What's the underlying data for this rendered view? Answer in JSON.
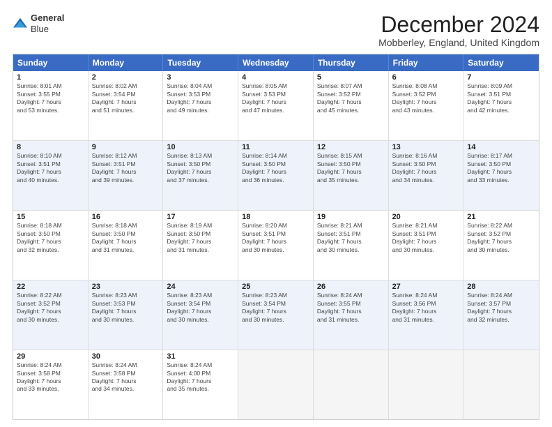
{
  "header": {
    "logo": {
      "line1": "General",
      "line2": "Blue"
    },
    "title": "December 2024",
    "location": "Mobberley, England, United Kingdom"
  },
  "weekdays": [
    "Sunday",
    "Monday",
    "Tuesday",
    "Wednesday",
    "Thursday",
    "Friday",
    "Saturday"
  ],
  "rows": [
    [
      {
        "day": "1",
        "info": "Sunrise: 8:01 AM\nSunset: 3:55 PM\nDaylight: 7 hours\nand 53 minutes."
      },
      {
        "day": "2",
        "info": "Sunrise: 8:02 AM\nSunset: 3:54 PM\nDaylight: 7 hours\nand 51 minutes."
      },
      {
        "day": "3",
        "info": "Sunrise: 8:04 AM\nSunset: 3:53 PM\nDaylight: 7 hours\nand 49 minutes."
      },
      {
        "day": "4",
        "info": "Sunrise: 8:05 AM\nSunset: 3:53 PM\nDaylight: 7 hours\nand 47 minutes."
      },
      {
        "day": "5",
        "info": "Sunrise: 8:07 AM\nSunset: 3:52 PM\nDaylight: 7 hours\nand 45 minutes."
      },
      {
        "day": "6",
        "info": "Sunrise: 8:08 AM\nSunset: 3:52 PM\nDaylight: 7 hours\nand 43 minutes."
      },
      {
        "day": "7",
        "info": "Sunrise: 8:09 AM\nSunset: 3:51 PM\nDaylight: 7 hours\nand 42 minutes."
      }
    ],
    [
      {
        "day": "8",
        "info": "Sunrise: 8:10 AM\nSunset: 3:51 PM\nDaylight: 7 hours\nand 40 minutes."
      },
      {
        "day": "9",
        "info": "Sunrise: 8:12 AM\nSunset: 3:51 PM\nDaylight: 7 hours\nand 39 minutes."
      },
      {
        "day": "10",
        "info": "Sunrise: 8:13 AM\nSunset: 3:50 PM\nDaylight: 7 hours\nand 37 minutes."
      },
      {
        "day": "11",
        "info": "Sunrise: 8:14 AM\nSunset: 3:50 PM\nDaylight: 7 hours\nand 36 minutes."
      },
      {
        "day": "12",
        "info": "Sunrise: 8:15 AM\nSunset: 3:50 PM\nDaylight: 7 hours\nand 35 minutes."
      },
      {
        "day": "13",
        "info": "Sunrise: 8:16 AM\nSunset: 3:50 PM\nDaylight: 7 hours\nand 34 minutes."
      },
      {
        "day": "14",
        "info": "Sunrise: 8:17 AM\nSunset: 3:50 PM\nDaylight: 7 hours\nand 33 minutes."
      }
    ],
    [
      {
        "day": "15",
        "info": "Sunrise: 8:18 AM\nSunset: 3:50 PM\nDaylight: 7 hours\nand 32 minutes."
      },
      {
        "day": "16",
        "info": "Sunrise: 8:18 AM\nSunset: 3:50 PM\nDaylight: 7 hours\nand 31 minutes."
      },
      {
        "day": "17",
        "info": "Sunrise: 8:19 AM\nSunset: 3:50 PM\nDaylight: 7 hours\nand 31 minutes."
      },
      {
        "day": "18",
        "info": "Sunrise: 8:20 AM\nSunset: 3:51 PM\nDaylight: 7 hours\nand 30 minutes."
      },
      {
        "day": "19",
        "info": "Sunrise: 8:21 AM\nSunset: 3:51 PM\nDaylight: 7 hours\nand 30 minutes."
      },
      {
        "day": "20",
        "info": "Sunrise: 8:21 AM\nSunset: 3:51 PM\nDaylight: 7 hours\nand 30 minutes."
      },
      {
        "day": "21",
        "info": "Sunrise: 8:22 AM\nSunset: 3:52 PM\nDaylight: 7 hours\nand 30 minutes."
      }
    ],
    [
      {
        "day": "22",
        "info": "Sunrise: 8:22 AM\nSunset: 3:52 PM\nDaylight: 7 hours\nand 30 minutes."
      },
      {
        "day": "23",
        "info": "Sunrise: 8:23 AM\nSunset: 3:53 PM\nDaylight: 7 hours\nand 30 minutes."
      },
      {
        "day": "24",
        "info": "Sunrise: 8:23 AM\nSunset: 3:54 PM\nDaylight: 7 hours\nand 30 minutes."
      },
      {
        "day": "25",
        "info": "Sunrise: 8:23 AM\nSunset: 3:54 PM\nDaylight: 7 hours\nand 30 minutes."
      },
      {
        "day": "26",
        "info": "Sunrise: 8:24 AM\nSunset: 3:55 PM\nDaylight: 7 hours\nand 31 minutes."
      },
      {
        "day": "27",
        "info": "Sunrise: 8:24 AM\nSunset: 3:56 PM\nDaylight: 7 hours\nand 31 minutes."
      },
      {
        "day": "28",
        "info": "Sunrise: 8:24 AM\nSunset: 3:57 PM\nDaylight: 7 hours\nand 32 minutes."
      }
    ],
    [
      {
        "day": "29",
        "info": "Sunrise: 8:24 AM\nSunset: 3:58 PM\nDaylight: 7 hours\nand 33 minutes."
      },
      {
        "day": "30",
        "info": "Sunrise: 8:24 AM\nSunset: 3:58 PM\nDaylight: 7 hours\nand 34 minutes."
      },
      {
        "day": "31",
        "info": "Sunrise: 8:24 AM\nSunset: 4:00 PM\nDaylight: 7 hours\nand 35 minutes."
      },
      {
        "day": "",
        "info": ""
      },
      {
        "day": "",
        "info": ""
      },
      {
        "day": "",
        "info": ""
      },
      {
        "day": "",
        "info": ""
      }
    ]
  ]
}
